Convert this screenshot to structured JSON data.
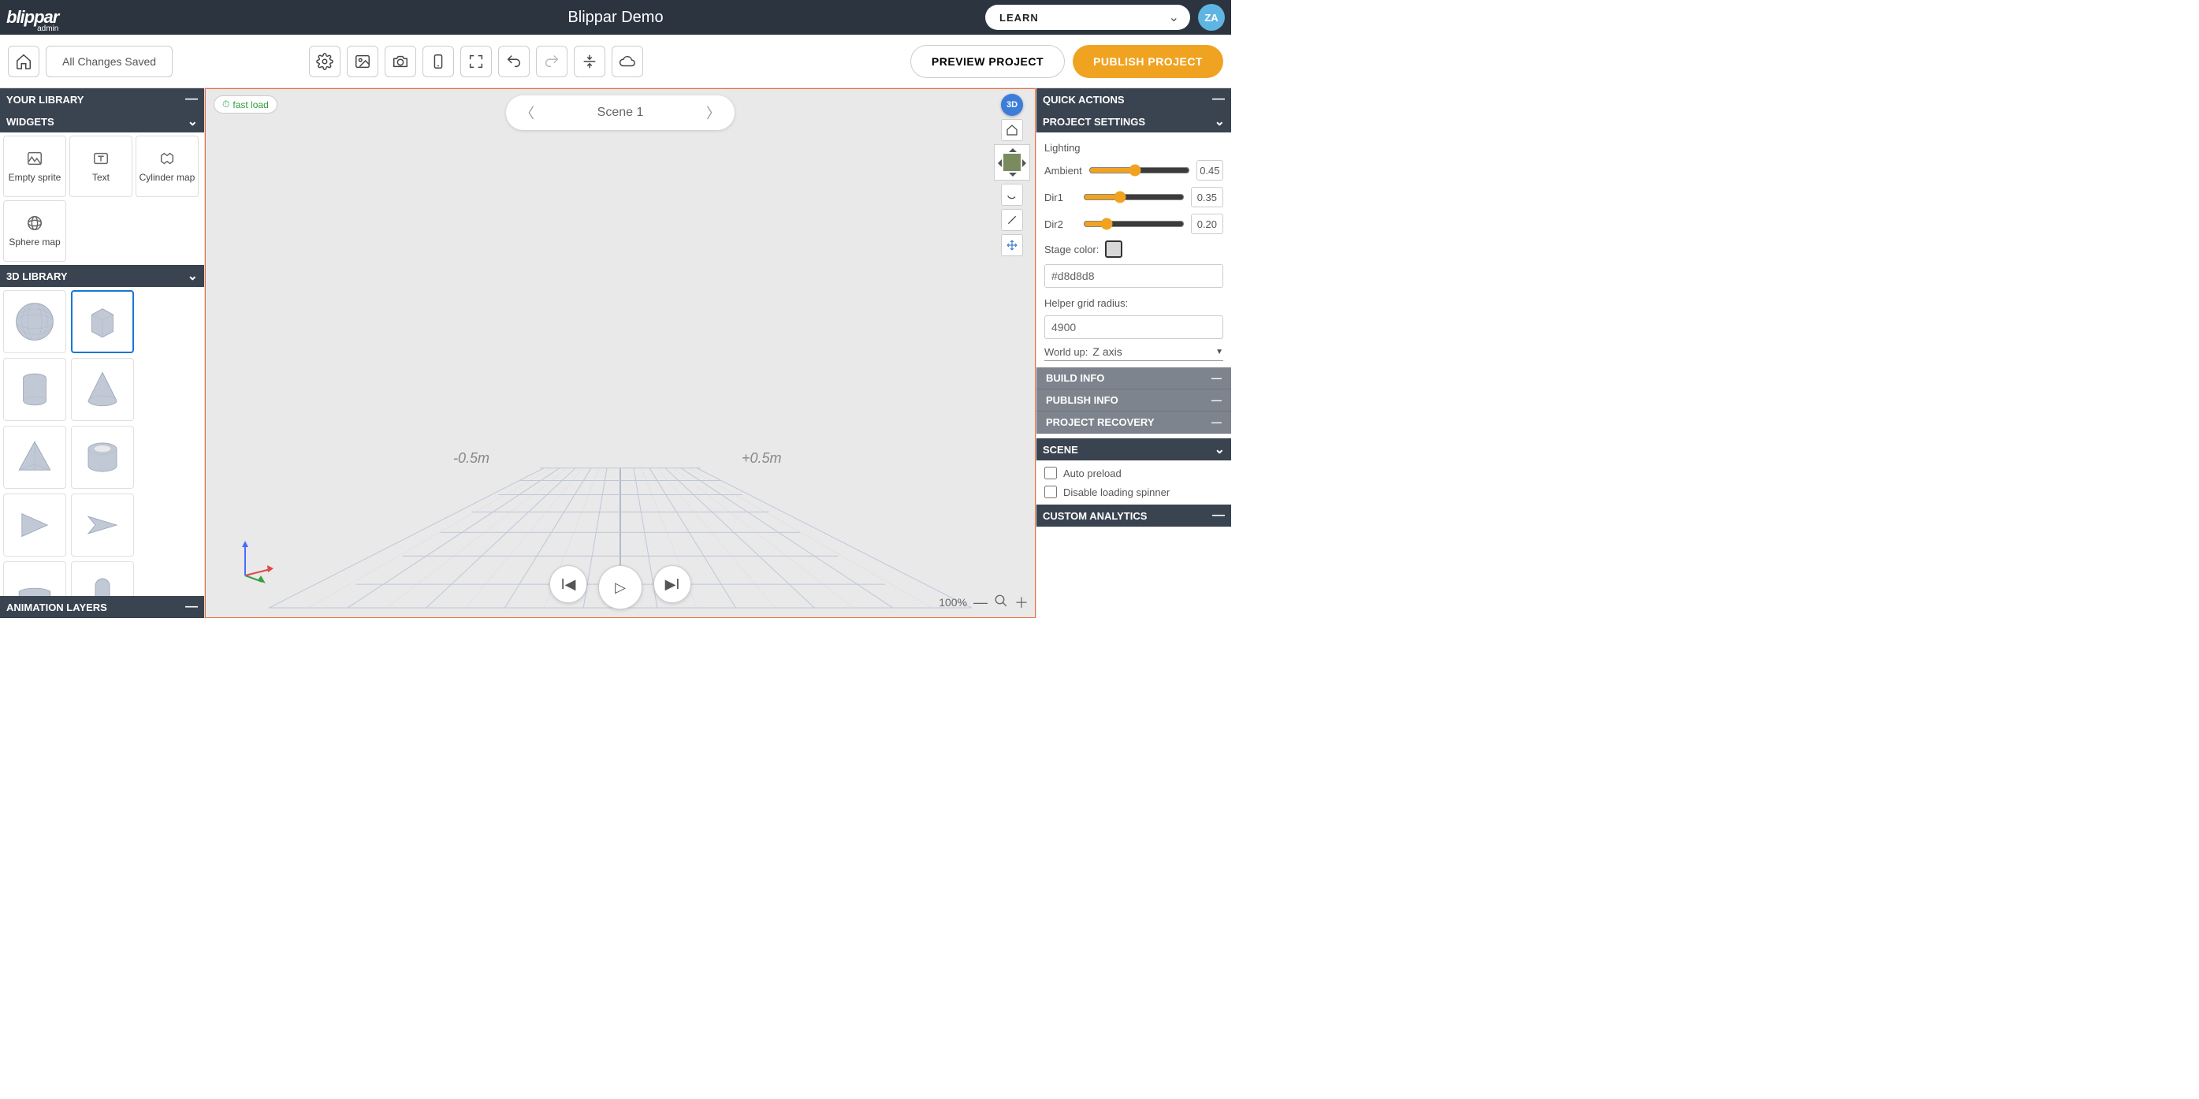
{
  "header": {
    "brand": "blippar",
    "brand_sub": "admin",
    "project_title": "Blippar Demo",
    "learn_label": "LEARN",
    "avatar": "ZA"
  },
  "toolbar": {
    "status": "All Changes Saved",
    "preview": "PREVIEW PROJECT",
    "publish": "PUBLISH PROJECT"
  },
  "left": {
    "your_library": "YOUR LIBRARY",
    "widgets_hdr": "WIDGETS",
    "widgets": [
      {
        "name": "Empty sprite"
      },
      {
        "name": "Text"
      },
      {
        "name": "Cylinder map"
      },
      {
        "name": "Sphere map"
      }
    ],
    "lib_hdr": "3D LIBRARY",
    "anim_hdr": "ANIMATION LAYERS"
  },
  "canvas": {
    "fast_load": "fast load",
    "scene_name": "Scene 1",
    "ruler_left": "-0.5m",
    "ruler_right": "+0.5m",
    "view3d": "3D",
    "zoom": "100%"
  },
  "right": {
    "quick_actions": "QUICK ACTIONS",
    "proj_settings": "PROJECT SETTINGS",
    "lighting_hdr": "Lighting",
    "ambient_lbl": "Ambient",
    "ambient_val": "0.45",
    "dir1_lbl": "Dir1",
    "dir1_val": "0.35",
    "dir2_lbl": "Dir2",
    "dir2_val": "0.20",
    "stage_color_lbl": "Stage color:",
    "stage_color_hex": "#d8d8d8",
    "grid_radius_lbl": "Helper grid radius:",
    "grid_radius_val": "4900",
    "world_up_lbl": "World up:",
    "world_up_val": "Z axis",
    "build_info": "BUILD INFO",
    "publish_info": "PUBLISH INFO",
    "proj_recovery": "PROJECT RECOVERY",
    "scene_hdr": "SCENE",
    "auto_preload": "Auto preload",
    "disable_spinner": "Disable loading spinner",
    "custom_analytics": "CUSTOM ANALYTICS"
  }
}
